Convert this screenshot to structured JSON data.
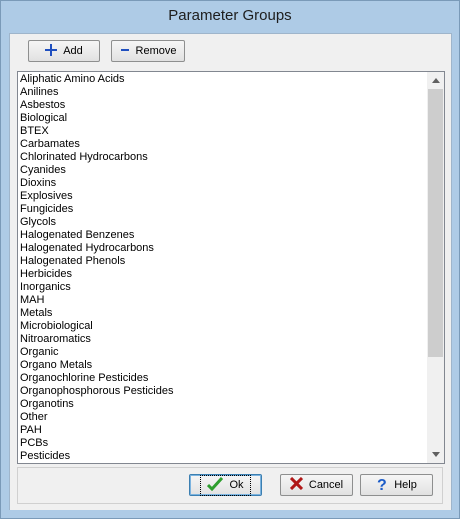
{
  "window": {
    "title": "Parameter Groups"
  },
  "toolbar": {
    "add_label": "Add",
    "remove_label": "Remove"
  },
  "list": {
    "items": [
      "Aliphatic Amino Acids",
      "Anilines",
      "Asbestos",
      "Biological",
      "BTEX",
      "Carbamates",
      "Chlorinated Hydrocarbons",
      "Cyanides",
      "Dioxins",
      "Explosives",
      "Fungicides",
      "Glycols",
      "Halogenated Benzenes",
      "Halogenated Hydrocarbons",
      "Halogenated Phenols",
      "Herbicides",
      "Inorganics",
      "MAH",
      "Metals",
      "Microbiological",
      "Nitroaromatics",
      "Organic",
      "Organo Metals",
      "Organochlorine Pesticides",
      "Organophosphorous Pesticides",
      "Organotins",
      "Other",
      "PAH",
      "PCBs",
      "Pesticides"
    ]
  },
  "footer": {
    "ok_label": "Ok",
    "cancel_label": "Cancel",
    "help_label": "Help"
  },
  "icons": {
    "add": "plus-icon",
    "remove": "minus-icon",
    "ok": "checkmark-icon",
    "cancel": "x-icon",
    "help": "question-icon"
  },
  "colors": {
    "window_frame": "#aecbe6",
    "plus": "#1f4fbf",
    "check": "#2e9e2e",
    "cancel_x": "#b01818",
    "help_q": "#1c5cc8"
  }
}
